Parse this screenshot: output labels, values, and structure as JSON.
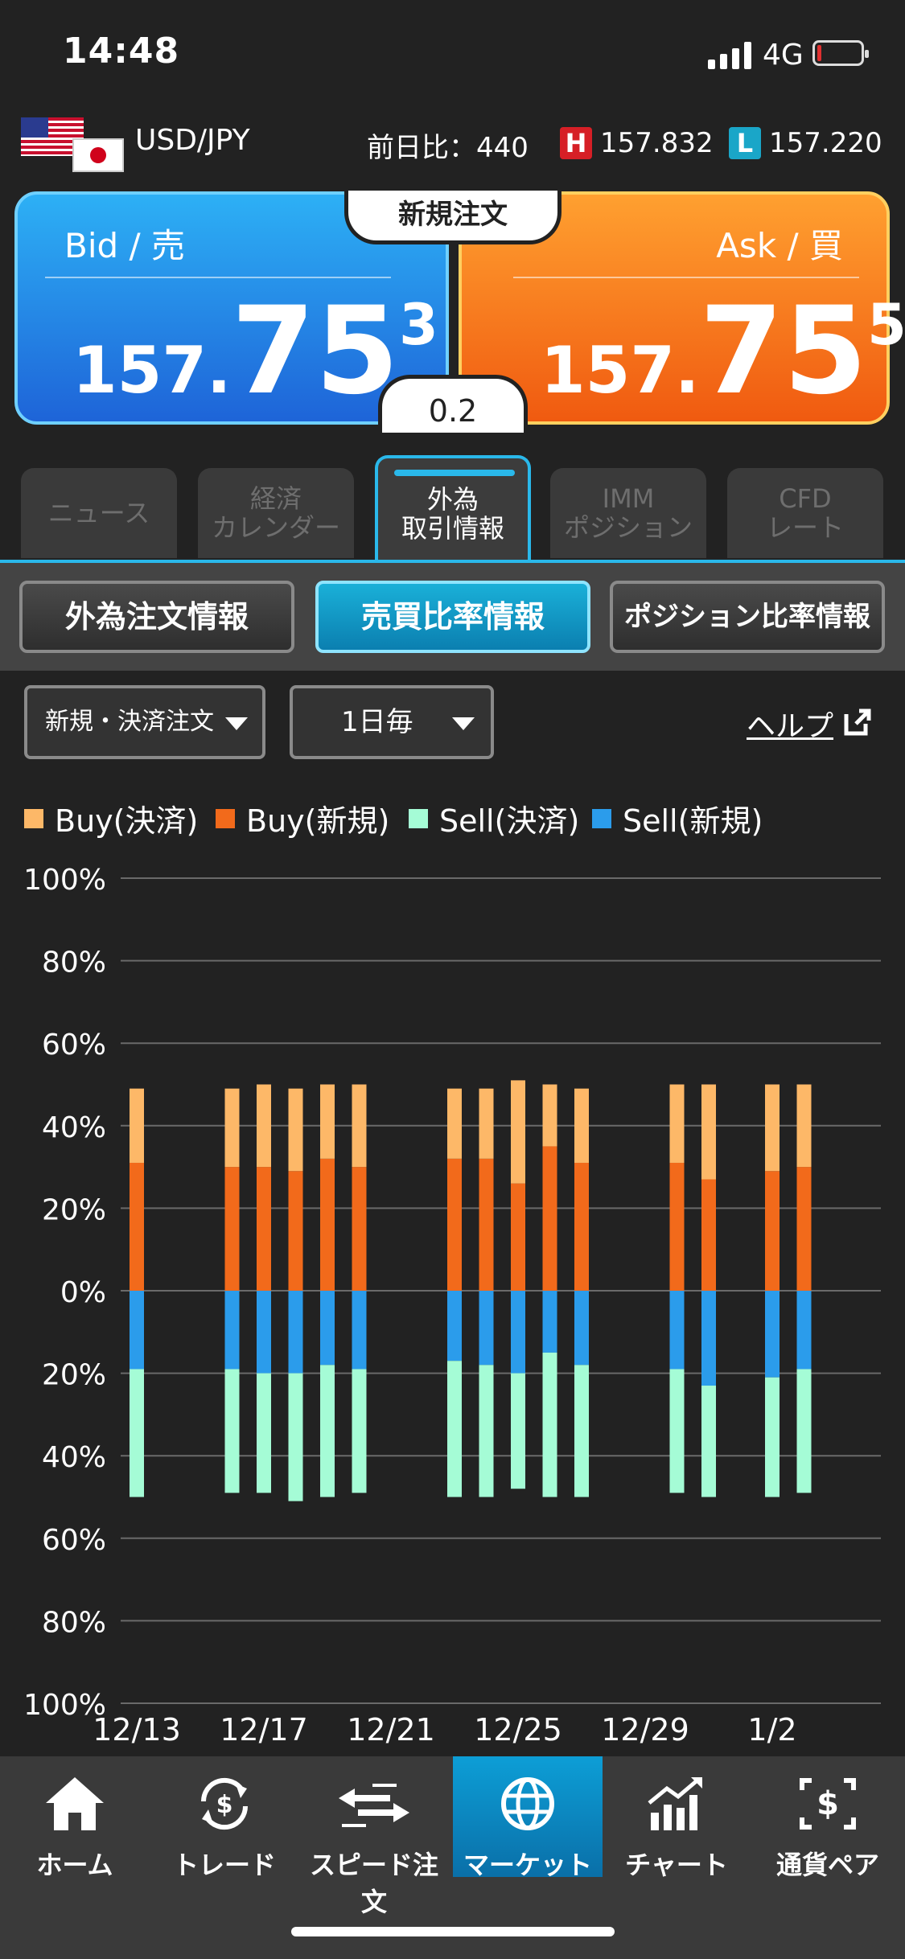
{
  "status": {
    "time": "14:48",
    "network": "4G"
  },
  "pair": {
    "name": "USD/JPY",
    "diff_label": "前日比：440",
    "high_badge": "H",
    "high": "157.832",
    "low_badge": "L",
    "low": "157.220"
  },
  "bid": {
    "label": "Bid / 売",
    "small": "157.",
    "big": "75",
    "sup": "3"
  },
  "ask": {
    "label": "Ask / 買",
    "small": "157.",
    "big": "75",
    "sup": "5"
  },
  "new_order": "新規注文",
  "spread": "0.2",
  "tabs": [
    {
      "line1": "ニュース",
      "line2": ""
    },
    {
      "line1": "経済",
      "line2": "カレンダー"
    },
    {
      "line1": "外為",
      "line2": "取引情報"
    },
    {
      "line1": "IMM",
      "line2": "ポジション"
    },
    {
      "line1": "CFD",
      "line2": "レート"
    }
  ],
  "subtabs": [
    "外為注文情報",
    "売買比率情報",
    "ポジション比率情報"
  ],
  "filters": {
    "order_type": "新規・決済注文",
    "period": "1日毎"
  },
  "help": "ヘルプ",
  "colors": {
    "buy_close": "#FDB868",
    "buy_new": "#F26A1B",
    "sell_close": "#A5FCD6",
    "sell_new": "#2B9CEB",
    "accent": "#2AB8EA"
  },
  "chart_data": {
    "type": "bar",
    "legend": [
      "Buy(決済)",
      "Buy(新規)",
      "Sell(決済)",
      "Sell(新規)"
    ],
    "yticks": [
      "100%",
      "80%",
      "60%",
      "40%",
      "20%",
      "0%",
      "20%",
      "40%",
      "60%",
      "80%",
      "100%"
    ],
    "xticks": [
      "12/13",
      "12/17",
      "12/21",
      "12/25",
      "12/29",
      "1/2"
    ],
    "ylim": [
      -100,
      100
    ],
    "grid": true,
    "categories": [
      "12/13",
      "12/16",
      "12/17",
      "12/18",
      "12/19",
      "12/20",
      "12/23",
      "12/24",
      "12/25",
      "12/26",
      "12/27",
      "12/30",
      "12/31",
      "1/2",
      "1/3"
    ],
    "series": [
      {
        "name": "Buy(新規)",
        "values": [
          31,
          30,
          30,
          29,
          32,
          30,
          32,
          32,
          26,
          35,
          31,
          31,
          27,
          29,
          30
        ]
      },
      {
        "name": "Buy(決済)",
        "values": [
          18,
          19,
          20,
          20,
          18,
          20,
          17,
          17,
          25,
          15,
          18,
          19,
          23,
          21,
          20
        ]
      },
      {
        "name": "Sell(新規)",
        "values": [
          19,
          19,
          20,
          20,
          18,
          19,
          17,
          18,
          20,
          15,
          18,
          19,
          23,
          21,
          19
        ]
      },
      {
        "name": "Sell(決済)",
        "values": [
          31,
          30,
          29,
          31,
          32,
          30,
          33,
          32,
          28,
          35,
          32,
          30,
          27,
          29,
          30
        ]
      }
    ]
  },
  "nav": [
    {
      "label": "ホーム",
      "icon": "home-icon"
    },
    {
      "label": "トレード",
      "icon": "trade-icon"
    },
    {
      "label": "スピード注文",
      "icon": "speed-order-icon"
    },
    {
      "label": "マーケット",
      "icon": "globe-icon"
    },
    {
      "label": "チャート",
      "icon": "chart-icon"
    },
    {
      "label": "通貨ペア",
      "icon": "currency-pair-icon"
    }
  ]
}
